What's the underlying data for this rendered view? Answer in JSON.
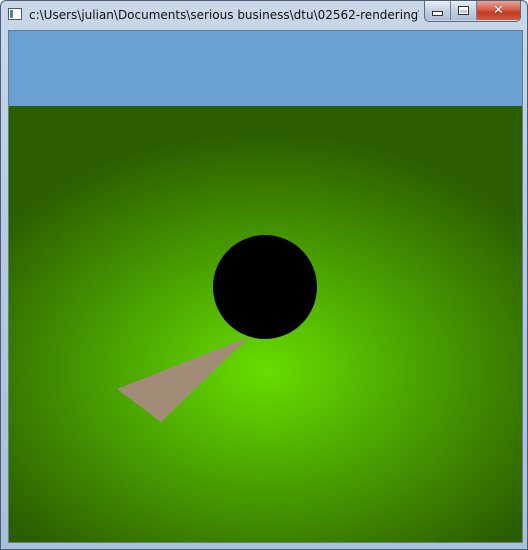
{
  "window": {
    "title": "c:\\Users\\julian\\Documents\\serious business\\dtu\\02562-rendering\\0256...",
    "app_icon": "window-app-icon",
    "controls": {
      "minimize_icon": "minimize-icon",
      "maximize_icon": "maximize-icon",
      "close_icon": "close-icon",
      "close_glyph": "✕"
    }
  },
  "scene": {
    "sky_color": "#6a9fd2",
    "ground_center_color": "#66dd00",
    "ground_edge_color": "#2b5e00",
    "sphere_color": "#000000",
    "triangle_color": "#a18c77"
  }
}
